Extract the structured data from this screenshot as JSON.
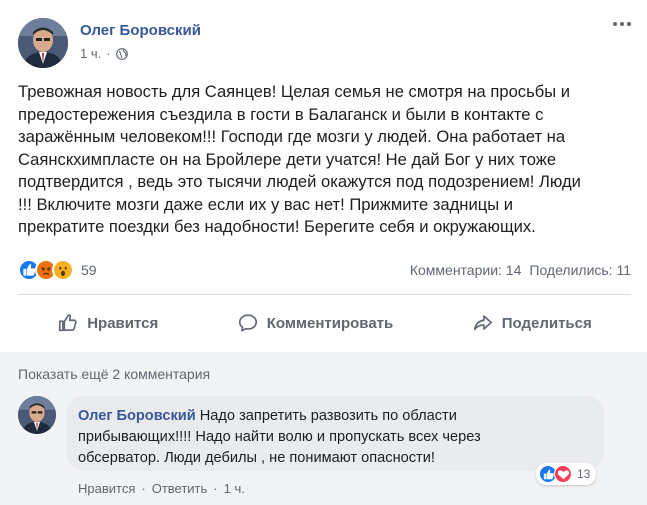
{
  "post": {
    "author": "Олег Боровский",
    "time": "1 ч.",
    "text_lines": [
      "Тревожная новость для Саянцев! Целая семья не смотря на просьбы и",
      "предостережения съездила в гости в Балаганск и были в контакте с",
      "заражённым человеком!!! Господи где мозги у людей. Она работает на",
      "Саянскхимпласте он на Бройлере дети учатся! Не дай Бог у них тоже",
      "подтвердится , ведь это тысячи людей окажутся под подозрением! Люди",
      "!!! Включите мозги даже если их у вас нет! Прижмите задницы и",
      "прекратите поездки без надобности! Берегите себя и окружающих."
    ],
    "reactions": {
      "icons": [
        "like-reaction",
        "angry-reaction",
        "wow-reaction"
      ],
      "count": "59"
    },
    "counts": {
      "comments": "Комментарии: 14",
      "shares": "Поделились: 11"
    },
    "actions": {
      "like": "Нравится",
      "comment": "Комментировать",
      "share": "Поделиться"
    }
  },
  "comments": {
    "show_more": "Показать ещё 2 комментария",
    "items": [
      {
        "author": "Олег Боровский",
        "text_first": "Надо запретить развозить по области",
        "text_rest": [
          "прибывающих!!!! Надо найти волю и пропускать всех через",
          "обсерватор. Люди дебилы , не понимают опасности!"
        ],
        "reactions": {
          "icons": [
            "like-reaction",
            "love-reaction"
          ],
          "count": "13"
        },
        "like": "Нравится",
        "reply": "Ответить",
        "sep": "·",
        "time": "1 ч."
      }
    ]
  },
  "colors": {
    "author_link": "#385898",
    "like_blue": "#1877f2",
    "angry_orange": "#e9710f",
    "wow_yellow": "#f7b125",
    "love_red": "#f33e58",
    "secondary_text": "#606770",
    "comment_bg": "#f2f3f5",
    "bubble_bg": "#e9ebee"
  }
}
